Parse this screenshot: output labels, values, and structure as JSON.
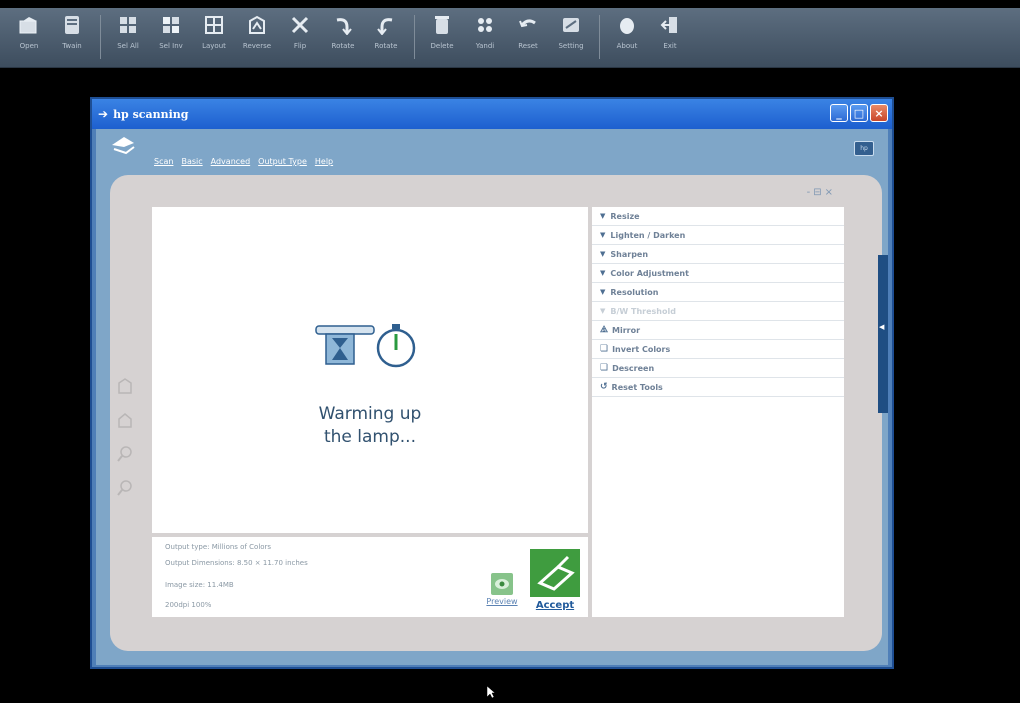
{
  "toolbar": {
    "buttons": [
      {
        "label": "Open",
        "icon": "open-icon"
      },
      {
        "label": "Twain",
        "icon": "twain-icon"
      },
      {
        "label": "Sel All",
        "icon": "select-all-icon"
      },
      {
        "label": "Sel Inv",
        "icon": "select-inverse-icon"
      },
      {
        "label": "Layout",
        "icon": "layout-icon"
      },
      {
        "label": "Reverse",
        "icon": "reverse-icon"
      },
      {
        "label": "Flip",
        "icon": "flip-icon"
      },
      {
        "label": "Rotate",
        "icon": "rotate-icon"
      },
      {
        "label": "Rotate",
        "icon": "rotate-icon"
      },
      {
        "label": "Delete",
        "icon": "delete-icon"
      },
      {
        "label": "Yandi",
        "icon": "yandi-icon"
      },
      {
        "label": "Reset",
        "icon": "reset-icon"
      },
      {
        "label": "Setting",
        "icon": "setting-icon"
      },
      {
        "label": "About",
        "icon": "about-icon"
      },
      {
        "label": "Exit",
        "icon": "exit-icon"
      }
    ]
  },
  "window": {
    "title": "hp scanning",
    "menu": [
      "Scan",
      "Basic",
      "Advanced",
      "Output Type",
      "Help"
    ]
  },
  "preview": {
    "status_line1": "Warming up",
    "status_line2": "the lamp..."
  },
  "info": {
    "output_type": "Output type: Millions of Colors",
    "output_dimensions": "Output Dimensions: 8.50 × 11.70 inches",
    "image_size": "Image size: 11.4MB",
    "resolution": "200dpi 100%"
  },
  "buttons": {
    "preview": "Preview",
    "accept": "Accept"
  },
  "tools": [
    {
      "label": "Resize",
      "kind": "expand",
      "enabled": true
    },
    {
      "label": "Lighten / Darken",
      "kind": "expand",
      "enabled": true
    },
    {
      "label": "Sharpen",
      "kind": "expand",
      "enabled": true
    },
    {
      "label": "Color Adjustment",
      "kind": "expand",
      "enabled": true
    },
    {
      "label": "Resolution",
      "kind": "expand",
      "enabled": true
    },
    {
      "label": "B/W Threshold",
      "kind": "expand",
      "enabled": false
    },
    {
      "label": "Mirror",
      "kind": "action",
      "icon": "mirror-icon",
      "enabled": true
    },
    {
      "label": "Invert Colors",
      "kind": "action",
      "icon": "invert-icon",
      "enabled": true
    },
    {
      "label": "Descreen",
      "kind": "action",
      "icon": "descreen-icon",
      "enabled": true
    },
    {
      "label": "Reset Tools",
      "kind": "action",
      "icon": "reset-tools-icon",
      "enabled": true
    }
  ]
}
